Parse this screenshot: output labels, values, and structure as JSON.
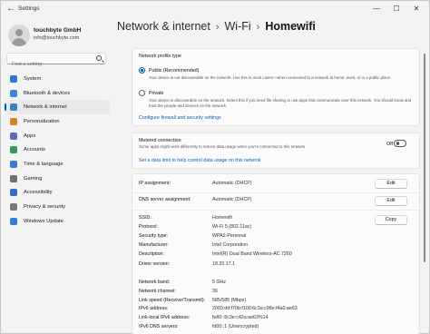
{
  "window": {
    "title": "Settings",
    "back_glyph": "←",
    "min_glyph": "—",
    "max_glyph": "☐",
    "close_glyph": "✕"
  },
  "user": {
    "name": "touchbyte GmbH",
    "email": "info@touchbyte.com"
  },
  "search": {
    "placeholder": "Find a setting",
    "icon": "search-icon"
  },
  "sidebar": {
    "items": [
      {
        "label": "System",
        "icon": "system-icon",
        "color": "#2b78d0"
      },
      {
        "label": "Bluetooth & devices",
        "icon": "bluetooth-icon",
        "color": "#3a86d6"
      },
      {
        "label": "Network & internet",
        "icon": "network-icon",
        "color": "#3b7fc4",
        "active": true
      },
      {
        "label": "Personalization",
        "icon": "personalization-icon",
        "color": "#d9822b"
      },
      {
        "label": "Apps",
        "icon": "apps-icon",
        "color": "#5c6bc0"
      },
      {
        "label": "Accounts",
        "icon": "accounts-icon",
        "color": "#2e9b5f"
      },
      {
        "label": "Time & language",
        "icon": "time-language-icon",
        "color": "#3a7bd5"
      },
      {
        "label": "Gaming",
        "icon": "gaming-icon",
        "color": "#6f6f6f"
      },
      {
        "label": "Accessibility",
        "icon": "accessibility-icon",
        "color": "#2f6fc9"
      },
      {
        "label": "Privacy & security",
        "icon": "shield-icon",
        "color": "#7a7a7a"
      },
      {
        "label": "Windows Update",
        "icon": "windows-update-icon",
        "color": "#2f80d6"
      }
    ]
  },
  "breadcrumb": {
    "part1": "Network & internet",
    "part2": "Wi-Fi",
    "current": "Homewifi",
    "sep": "›"
  },
  "profile": {
    "title": "Network profile type",
    "public_label": "Public (Recommended)",
    "public_desc": "Your device is not discoverable on the network. Use this in most cases—when connected to a network at home, work, or in a public place",
    "private_label": "Private",
    "private_desc": "Your device is discoverable on the network. Select this if you need file sharing or use apps that communicate over this network. You should know and trust the people and devices on the network.",
    "firewall_link": "Configure firewall and security settings"
  },
  "metered": {
    "label": "Metered connection",
    "desc": "Some apps might work differently to reduce data usage when you're connected to this network",
    "toggle_text": "Off",
    "data_limit_link": "Set a data limit to help control data usage on this netwrok"
  },
  "ip": {
    "ip_label": "IP assignment:",
    "ip_value": "Automatic (DHCP)",
    "dns_label": "DNS server assignment:",
    "dns_value": "Automatic (DHCP)",
    "edit_label": "Edit",
    "copy_label": "Copy"
  },
  "properties": [
    {
      "label": "SSID:",
      "value": "Homewifi"
    },
    {
      "label": "Protocol:",
      "value": "Wi-Fi 5 (802.11ac)"
    },
    {
      "label": "Security type:",
      "value": "WPA2-Personal"
    },
    {
      "label": "Manufacturer:",
      "value": "Intel Corporation"
    },
    {
      "label": "Description:",
      "value": "Intel(R) Dual Band Wireless-AC 7260"
    },
    {
      "label": "Driver version:",
      "value": "18.33.17.1"
    },
    {
      "label": "Network band:",
      "value": "5 GHz"
    },
    {
      "label": "Network channel:",
      "value": "36"
    },
    {
      "label": "Link speed (Receive/Transmit):",
      "value": "585/585 (Mbps)"
    },
    {
      "label": "IPv6 address:",
      "value": "2003:dd:f70b:f100:6c3a:c98e:f4a0:ae63"
    },
    {
      "label": "Link-local IPv6 address:",
      "value": "fe80::8c3e:c42a:ae63%14"
    },
    {
      "label": "IPv6 DNS servers:",
      "value": "fd00::1 (Unencrypted)"
    }
  ]
}
